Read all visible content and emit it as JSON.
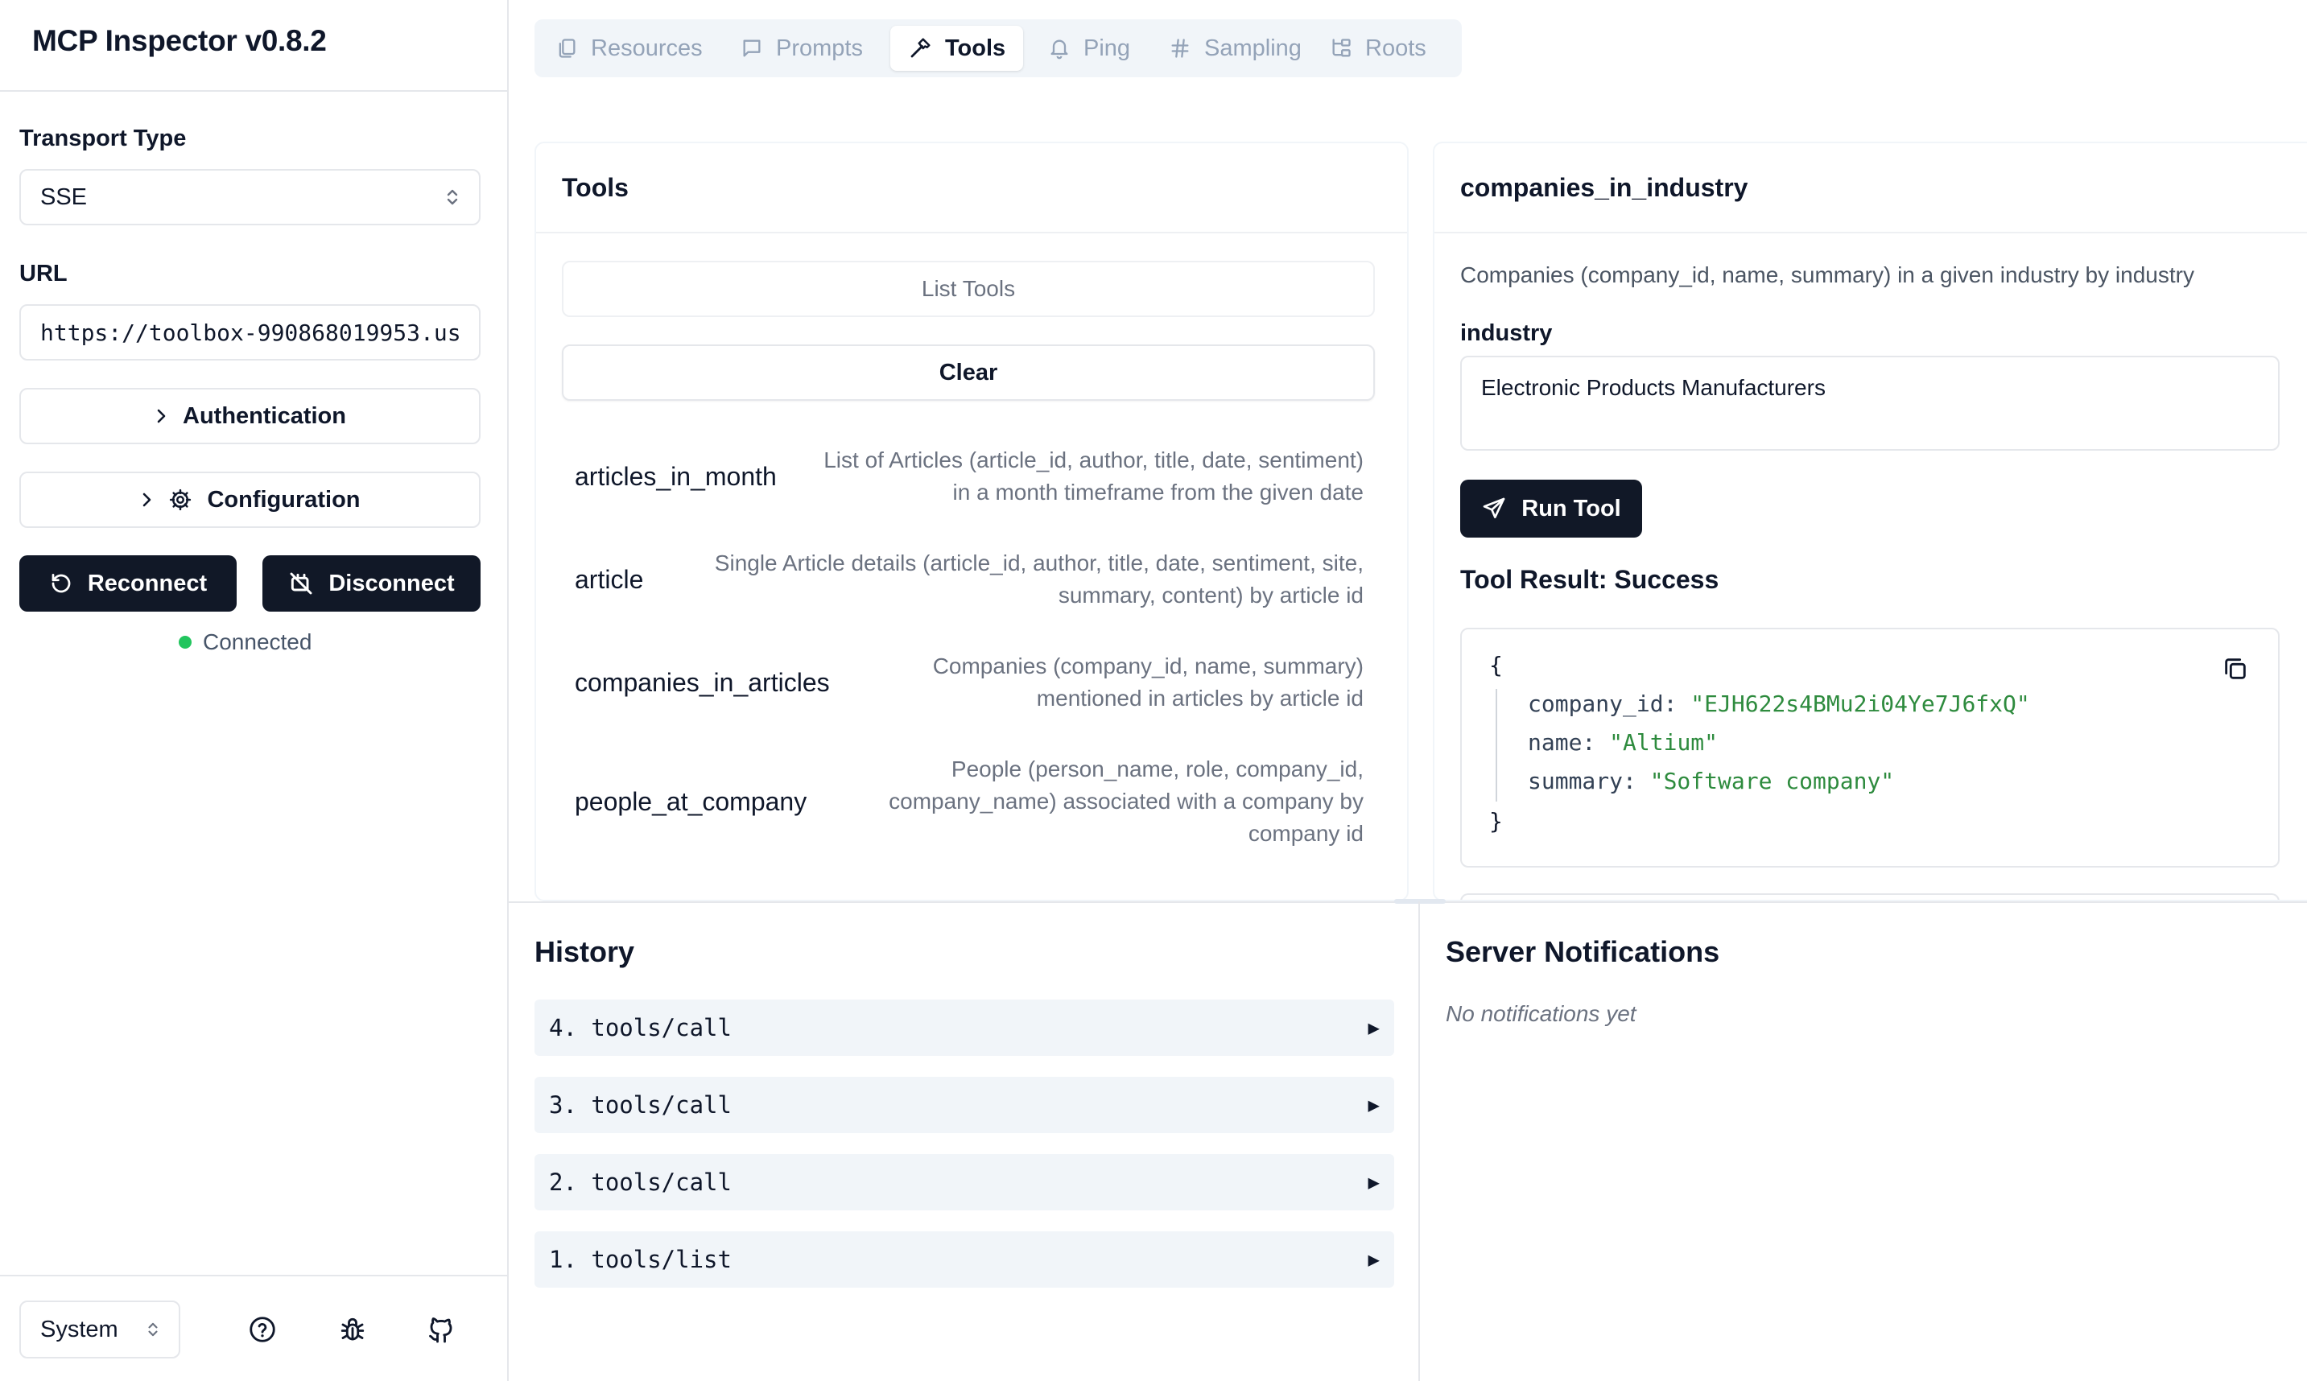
{
  "app": {
    "title": "MCP Inspector v0.8.2"
  },
  "sidebar": {
    "transport_label": "Transport Type",
    "transport_value": "SSE",
    "url_label": "URL",
    "url_value": "https://toolbox-990868019953.us",
    "authentication_label": "Authentication",
    "configuration_label": "Configuration",
    "reconnect_label": "Reconnect",
    "disconnect_label": "Disconnect",
    "status_text": "Connected",
    "theme_value": "System"
  },
  "tabs": [
    {
      "label": "Resources",
      "icon": "files-icon",
      "active": false
    },
    {
      "label": "Prompts",
      "icon": "message-icon",
      "active": false
    },
    {
      "label": "Tools",
      "icon": "hammer-icon",
      "active": true
    },
    {
      "label": "Ping",
      "icon": "bell-icon",
      "active": false
    },
    {
      "label": "Sampling",
      "icon": "hash-icon",
      "active": false
    },
    {
      "label": "Roots",
      "icon": "folder-tree-icon",
      "active": false
    }
  ],
  "tools_panel": {
    "title": "Tools",
    "list_tools_label": "List Tools",
    "clear_label": "Clear",
    "tools": [
      {
        "name": "articles_in_month",
        "description": [
          "List of Articles (article_id, author, title, date, sentiment)",
          "in a month timeframe from the given date"
        ]
      },
      {
        "name": "article",
        "description": [
          "Single Article details (article_id, author, title, date, sentiment, site,",
          "summary, content) by article id"
        ]
      },
      {
        "name": "companies_in_articles",
        "description": [
          "Companies (company_id, name, summary)",
          "mentioned in articles by article id"
        ]
      },
      {
        "name": "people_at_company",
        "description": [
          "People (person_name, role, company_id,",
          "company_name) associated with a company by",
          "company id"
        ]
      }
    ]
  },
  "tool_detail": {
    "title": "companies_in_industry",
    "description": "Companies (company_id, name, summary) in a given industry by industry",
    "param_label": "industry",
    "param_value": "Electronic Products Manufacturers",
    "run_label": "Run Tool",
    "result_title": "Tool Result: Success",
    "result": {
      "open_brace": "{",
      "close_brace": "}",
      "fields": [
        {
          "key": "company_id:",
          "value": "\"EJH622s4BMu2i04Ye7J6fxQ\""
        },
        {
          "key": "name:",
          "value": "\"Altium\""
        },
        {
          "key": "summary:",
          "value": "\"Software company\""
        }
      ]
    }
  },
  "history": {
    "title": "History",
    "items": [
      "4. tools/call",
      "3. tools/call",
      "2. tools/call",
      "1. tools/list"
    ]
  },
  "notifications": {
    "title": "Server Notifications",
    "empty_text": "No notifications yet"
  },
  "colors": {
    "primary_button": "#111827",
    "status_ok": "#22c55e",
    "json_string": "#2e8b3e"
  }
}
